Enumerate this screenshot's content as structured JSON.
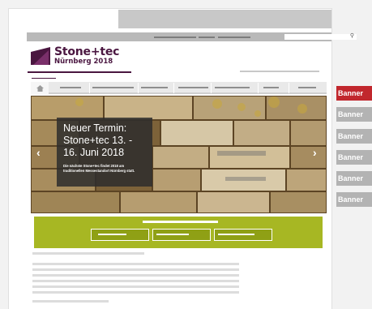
{
  "logo": {
    "title": "Stone+tec",
    "subtitle": "Nürnberg 2018",
    "brand_color": "#4a1640"
  },
  "search": {
    "placeholder": "",
    "icon": "search-icon"
  },
  "nav": {
    "home_icon": "home-icon"
  },
  "hero": {
    "headline": "Neuer Termin: Stone+tec 13. - 16. Juni 2018",
    "description": "Die nächste Stone+tec findet 2018 am traditionellen Messestandort Nürnberg statt.",
    "prev_label": "‹",
    "next_label": "›"
  },
  "promo": {
    "accent_color": "#a7b723"
  },
  "banners": [
    {
      "label": "Banner",
      "active": true
    },
    {
      "label": "Banner",
      "active": false
    },
    {
      "label": "Banner",
      "active": false
    },
    {
      "label": "Banner",
      "active": false
    },
    {
      "label": "Banner",
      "active": false
    },
    {
      "label": "Banner",
      "active": false
    }
  ],
  "colors": {
    "banner_active": "#c1272d",
    "banner_inactive": "#b3b3b3"
  }
}
